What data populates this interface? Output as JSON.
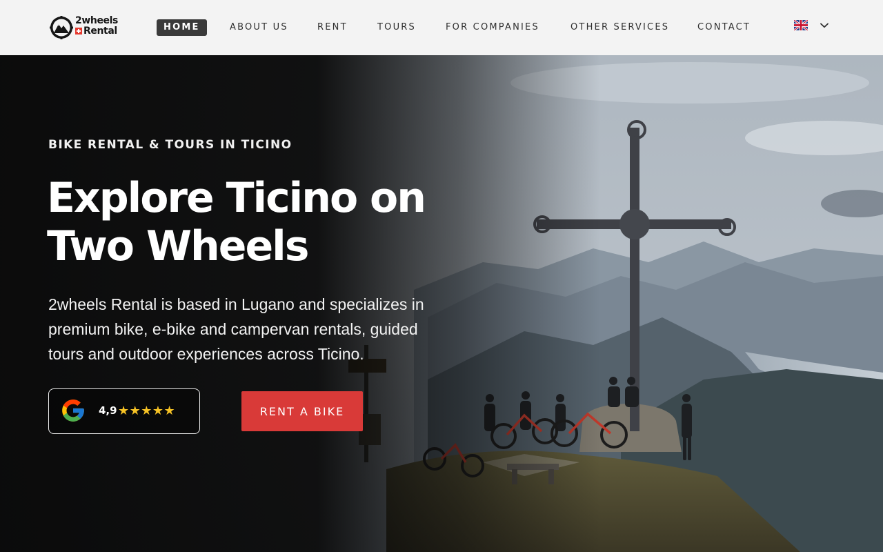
{
  "header": {
    "logo": {
      "line1": "2wheels",
      "line2": "Rental"
    },
    "nav": [
      {
        "label": "HOME",
        "active": true
      },
      {
        "label": "ABOUT US",
        "active": false
      },
      {
        "label": "RENT",
        "active": false
      },
      {
        "label": "TOURS",
        "active": false
      },
      {
        "label": "FOR COMPANIES",
        "active": false
      },
      {
        "label": "OTHER SERVICES",
        "active": false
      },
      {
        "label": "CONTACT",
        "active": false
      }
    ],
    "language": {
      "flag_icon": "uk-flag-icon",
      "dropdown_icon": "chevron-down-icon"
    }
  },
  "hero": {
    "eyebrow": "BIKE RENTAL & TOURS IN TICINO",
    "headline_line1": "Explore Ticino on",
    "headline_line2": "Two Wheels",
    "description": "2wheels Rental is based in Lugano and specializes in premium bike, e-bike and campervan rentals, guided tours and outdoor experiences across Ticino.",
    "review": {
      "icon": "google-icon",
      "rating": "4,9",
      "stars": "★★★★★",
      "star_count": 5
    },
    "cta_label": "RENT A BIKE"
  },
  "colors": {
    "header_bg": "#f3f3f3",
    "nav_active_bg": "#3a3a3a",
    "cta_bg": "#d93a38",
    "star": "#f7c325",
    "hero_overlay": "#080808"
  }
}
